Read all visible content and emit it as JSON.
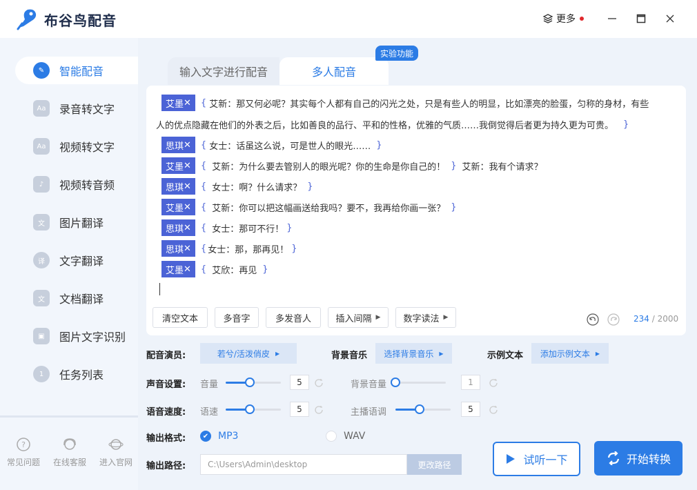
{
  "app": {
    "title": "布谷鸟配音",
    "more_label": "更多"
  },
  "sidebar": {
    "items": [
      {
        "label": "智能配音",
        "icon": "smart-dubbing-icon",
        "active": true
      },
      {
        "label": "录音转文字",
        "icon": "audio-to-text-icon"
      },
      {
        "label": "视频转文字",
        "icon": "video-to-text-icon"
      },
      {
        "label": "视频转音频",
        "icon": "video-to-audio-icon"
      },
      {
        "label": "图片翻译",
        "icon": "image-translate-icon"
      },
      {
        "label": "文字翻译",
        "icon": "text-translate-icon"
      },
      {
        "label": "文档翻译",
        "icon": "document-translate-icon"
      },
      {
        "label": "图片文字识别",
        "icon": "ocr-icon"
      },
      {
        "label": "任务列表",
        "icon": "task-list-icon",
        "badge": "1"
      }
    ],
    "footer": [
      {
        "label": "常见问题",
        "icon": "help-icon"
      },
      {
        "label": "在线客服",
        "icon": "customer-service-icon"
      },
      {
        "label": "进入官网",
        "icon": "website-icon"
      }
    ]
  },
  "tabs": {
    "tab1": "输入文字进行配音",
    "tab2": "多人配音",
    "badge": "实验功能"
  },
  "editor": {
    "tag_close": "✕",
    "brace_open": "{",
    "brace_close": "}",
    "lines": [
      {
        "speaker": "艾墨",
        "text": "艾新：那又何必呢？其实每个人都有自己的闪光之处，只是有些人的明显，比如漂亮的脸蛋，匀称的身材，有些"
      },
      {
        "text": "人的优点隐藏在他们的外表之后，比如善良的品行、平和的性格，优雅的气质……我倒觉得后者更为持久更为可贵。"
      },
      {
        "speaker": "思琪",
        "text": "女士：话虽这么说，可是世人的眼光……"
      },
      {
        "speaker": "艾墨",
        "text": "艾新：为什么要去管别人的眼光呢？你的生命是你自己的！",
        "extra": "艾新：我有个请求？"
      },
      {
        "speaker": "思琪",
        "text": "女士：啊？什么请求？"
      },
      {
        "speaker": "艾墨",
        "text": "艾新：你可以把这幅画送给我吗？要不，我再给你画一张？"
      },
      {
        "speaker": "思琪",
        "text": "女士：那可不行！"
      },
      {
        "speaker": "思琪",
        "text": "女士：那，那再见！"
      },
      {
        "speaker": "艾墨",
        "text": "艾欣：再见"
      }
    ],
    "buttons": {
      "clear": "清空文本",
      "polyphone": "多音字",
      "multi_speaker": "多发音人",
      "insert_pause": "插入间隔",
      "number_reading": "数字读法"
    },
    "count_current": "234",
    "count_max": "/ 2000"
  },
  "settings": {
    "voice_actor_label": "配音演员:",
    "voice_actor_value": "若兮/活泼俏皮",
    "bgm_label": "背景音乐",
    "bgm_value": "选择背景音乐",
    "sample_label": "示例文本",
    "sample_value": "添加示例文本",
    "sound_label": "声音设置:",
    "volume_label": "音量",
    "volume_value": "5",
    "bg_volume_label": "背景音量",
    "bg_volume_value": "1",
    "speed_label": "语音速度:",
    "rate_label": "语速",
    "rate_value": "5",
    "pitch_label": "主播语调",
    "pitch_value": "5",
    "format_label": "输出格式:",
    "format_mp3": "MP3",
    "format_wav": "WAV",
    "selected_format": "MP3",
    "path_label": "输出路径:",
    "path_value": "C:\\Users\\Admin\\desktop",
    "change_path": "更改路径"
  },
  "actions": {
    "listen": "试听一下",
    "start": "开始转换"
  },
  "colors": {
    "accent": "#2c7ce5",
    "tag": "#4b63d6",
    "notification_dot": "#e0282c"
  }
}
